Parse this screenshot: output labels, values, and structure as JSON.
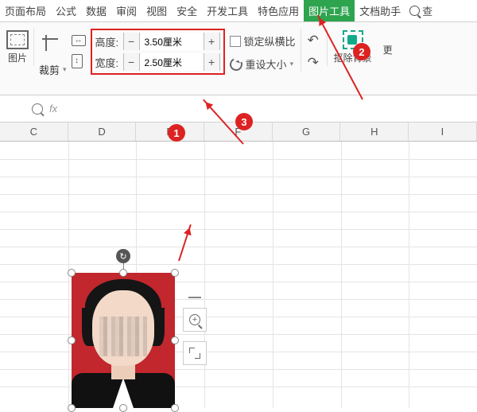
{
  "tabs": {
    "page_layout": "页面布局",
    "formula": "公式",
    "data": "数据",
    "review": "审阅",
    "view": "视图",
    "security": "安全",
    "dev_tools": "开发工具",
    "special": "特色应用",
    "picture_tools": "图片工具",
    "doc_helper": "文档助手",
    "search": "查"
  },
  "ribbon": {
    "picture_label": "图片",
    "crop_label": "裁剪",
    "height_label": "高度:",
    "width_label": "宽度:",
    "height_value": "3.50厘米",
    "width_value": "2.50厘米",
    "minus": "−",
    "plus": "+",
    "lock_ratio": "锁定纵横比",
    "reset_size": "重设大小",
    "remove_bg": "抠除背景",
    "more": "更"
  },
  "formula_bar": {
    "fx": "fx"
  },
  "columns": [
    "C",
    "D",
    "E",
    "F",
    "G",
    "H",
    "I"
  ],
  "callouts": {
    "c1": "1",
    "c2": "2",
    "c3": "3"
  },
  "rotate_glyph": "↻"
}
